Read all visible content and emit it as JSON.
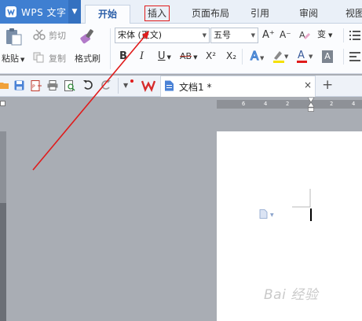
{
  "app": {
    "name": "WPS 文字",
    "accent": "#3f7fd1"
  },
  "tabs": {
    "home": "开始",
    "insert": "插入",
    "layout": "页面布局",
    "reference": "引用",
    "review": "审阅",
    "view": "视图"
  },
  "ribbon": {
    "paste": "粘贴",
    "cut": "剪切",
    "copy": "复制",
    "format_painter": "格式刷",
    "font_name": "宋体 (正文)",
    "font_size": "五号",
    "bold": "B",
    "italic": "I",
    "underline": "U",
    "strikethrough": "AB",
    "superscript": "X²",
    "subscript": "X₂",
    "grow_font": "A⁺",
    "shrink_font": "A⁻",
    "pinyin": "变"
  },
  "document": {
    "tab_title": "文档1 *",
    "close": "×",
    "new_tab": "+"
  },
  "ruler": {
    "labels": [
      "6",
      "4",
      "2",
      "2",
      "4"
    ]
  },
  "annotation": {
    "highlight_color": "#e01b1b"
  },
  "watermark": "Bai 经验"
}
